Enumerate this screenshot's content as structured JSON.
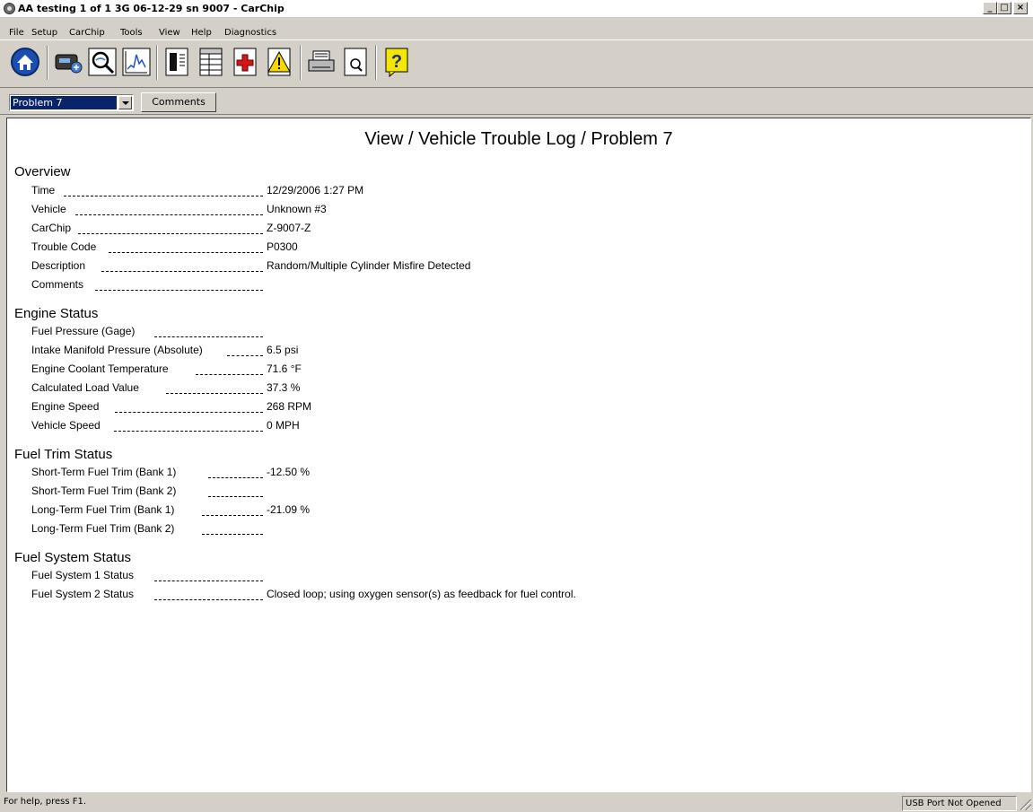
{
  "window": {
    "title": "AA testing 1 of 1 3G 06-12-29 sn 9007 - CarChip",
    "min_glyph": "_",
    "max_glyph": "□",
    "close_glyph": "×"
  },
  "menu": {
    "items": [
      "File",
      "Setup",
      "CarChip",
      "Tools",
      "View",
      "Help",
      "Diagnostics"
    ]
  },
  "toolbar": {
    "buttons": [
      "home-icon",
      "carchip-device-icon",
      "magnify-view-icon",
      "graph-icon",
      "log-report-icon",
      "table-report-icon",
      "health-report-icon",
      "warning-report-icon",
      "print-icon",
      "print-preview-icon",
      "help-icon"
    ]
  },
  "selector": {
    "selected": "Problem 7",
    "comments_button": "Comments"
  },
  "page": {
    "title": "View / Vehicle Trouble Log / Problem 7",
    "sections": [
      {
        "heading": "Overview",
        "rows": [
          {
            "label": "Time",
            "value": "12/29/2006 1:27 PM"
          },
          {
            "label": "Vehicle",
            "value": "Unknown #3"
          },
          {
            "label": "CarChip",
            "value": "Z-9007-Z"
          },
          {
            "label": "Trouble Code",
            "value": "P0300"
          },
          {
            "label": "Description",
            "value": "Random/Multiple Cylinder Misfire Detected"
          },
          {
            "label": "Comments",
            "value": ""
          }
        ]
      },
      {
        "heading": "Engine Status",
        "rows": [
          {
            "label": "Fuel Pressure (Gage)",
            "value": ""
          },
          {
            "label": "Intake Manifold Pressure (Absolute)",
            "value": "6.5 psi"
          },
          {
            "label": "Engine Coolant Temperature",
            "value": "71.6 °F"
          },
          {
            "label": "Calculated Load Value",
            "value": "37.3 %"
          },
          {
            "label": "Engine Speed",
            "value": "268 RPM"
          },
          {
            "label": "Vehicle Speed",
            "value": "0 MPH"
          }
        ]
      },
      {
        "heading": "Fuel Trim Status",
        "rows": [
          {
            "label": "Short-Term Fuel Trim (Bank 1)",
            "value": "-12.50 %"
          },
          {
            "label": "Short-Term Fuel Trim (Bank 2)",
            "value": ""
          },
          {
            "label": "Long-Term Fuel Trim (Bank 1)",
            "value": "-21.09 %"
          },
          {
            "label": "Long-Term Fuel Trim (Bank 2)",
            "value": ""
          }
        ]
      },
      {
        "heading": "Fuel System Status",
        "rows": [
          {
            "label": "Fuel System 1 Status",
            "value": ""
          },
          {
            "label": "Fuel System 2 Status",
            "value": "Closed loop; using oxygen sensor(s) as feedback for fuel control."
          }
        ]
      }
    ]
  },
  "status": {
    "help": "For help, press F1.",
    "port": "USB Port Not Opened"
  }
}
